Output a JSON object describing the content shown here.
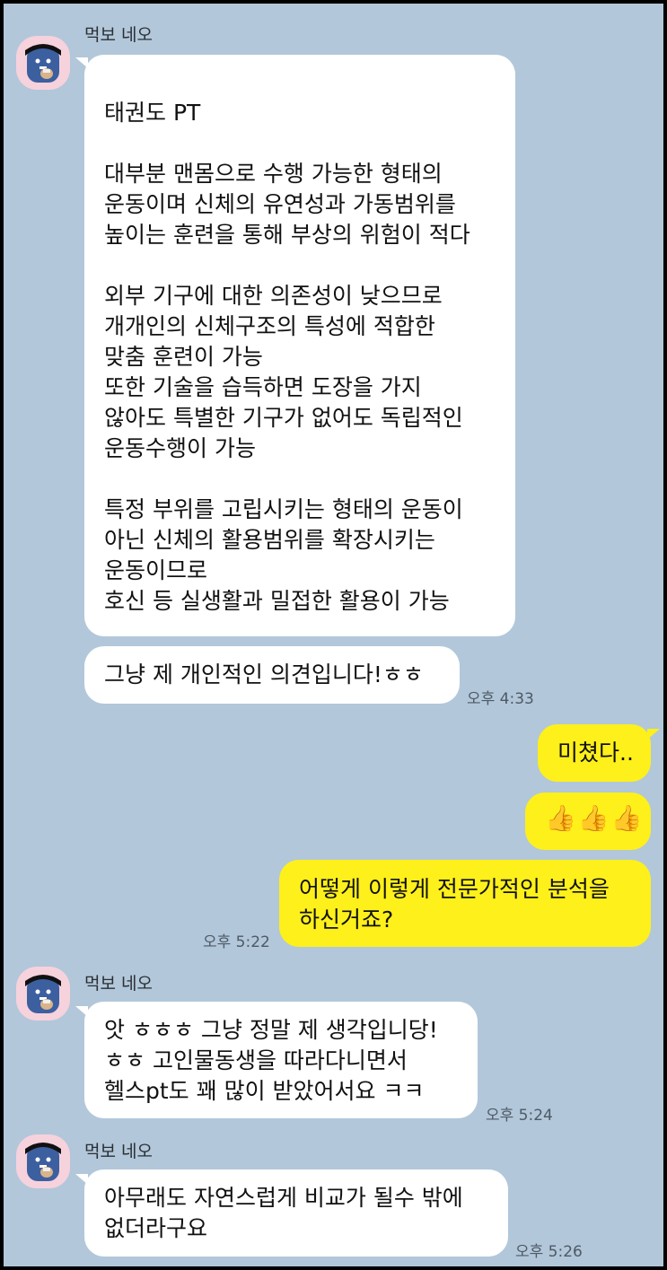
{
  "sender_name": "먹보 네오",
  "msg1": {
    "lines": [
      "태권도 PT",
      "",
      "대부분 맨몸으로 수행 가능한 형태의",
      "운동이며 신체의 유연성과 가동범위를",
      "높이는 훈련을 통해 부상의 위험이 적다",
      "",
      "외부 기구에 대한 의존성이 낮으므로",
      "개개인의 신체구조의 특성에 적합한",
      "맞춤 훈련이 가능",
      "또한 기술을 습득하면 도장을 가지",
      "않아도 특별한 기구가 없어도 독립적인",
      "운동수행이 가능",
      "",
      "특정 부위를 고립시키는 형태의 운동이",
      "아닌 신체의 활용범위를 확장시키는",
      "운동이므로",
      "호신 등 실생활과 밀접한 활용이 가능"
    ]
  },
  "msg2": {
    "text": "그냥 제 개인적인 의견입니다!ㅎㅎ",
    "time": "오후 4:33"
  },
  "msg3": {
    "text": "미쳤다.."
  },
  "msg4": {
    "text": "👍👍👍",
    "icon": "thumbs-up-icon"
  },
  "msg5": {
    "lines": [
      "어떻게 이렇게 전문가적인 분석을",
      "하신거죠?"
    ],
    "time": "오후 5:22"
  },
  "msg6": {
    "lines": [
      "앗 ㅎㅎㅎ 그냥 정말 제 생각입니당!",
      "ㅎㅎ 고인물동생을 따라다니면서",
      "헬스pt도 꽤 많이 받았어서요 ㅋㅋ"
    ],
    "time": "오후 5:24"
  },
  "msg7": {
    "lines": [
      "아무래도 자연스럽게 비교가 될수 밖에",
      "없더라구요"
    ],
    "time": "오후 5:26"
  },
  "colors": {
    "background": "#b2c7da",
    "bubble_in": "#ffffff",
    "bubble_out": "#fef01b",
    "avatar_bg": "#f6d2dc"
  }
}
